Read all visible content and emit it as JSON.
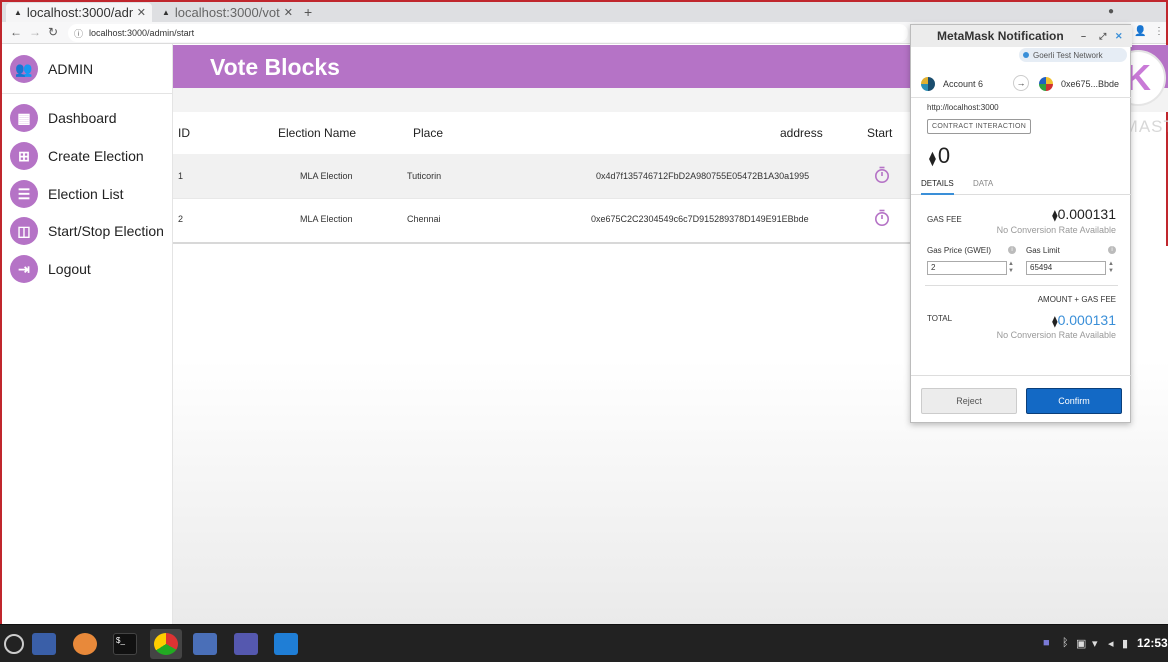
{
  "browser": {
    "tabs": [
      {
        "label": "localhost:3000/adm",
        "active": true
      },
      {
        "label": "localhost:3000/vot",
        "active": false
      }
    ],
    "url": "localhost:3000/admin/start"
  },
  "sidebar": {
    "title": "ADMIN",
    "items": [
      {
        "label": "Dashboard",
        "icon": "dashboard-icon"
      },
      {
        "label": "Create Election",
        "icon": "add-box-icon"
      },
      {
        "label": "Election List",
        "icon": "list-icon"
      },
      {
        "label": "Start/Stop Election",
        "icon": "start-stop-icon"
      },
      {
        "label": "Logout",
        "icon": "logout-icon"
      }
    ]
  },
  "header": {
    "title": "Vote Blocks"
  },
  "table": {
    "columns": [
      "ID",
      "Election Name",
      "Place",
      "address",
      "Start"
    ],
    "rows": [
      {
        "id": "1",
        "name": "MLA Election",
        "place": "Tuticorin",
        "address": "0x4d7f135746712FbD2A980755E05472B1A30a1995"
      },
      {
        "id": "2",
        "name": "MLA Election",
        "place": "Chennai",
        "address": "0xe675C2C2304549c6c7D915289378D149E91EBbde"
      }
    ]
  },
  "metamask": {
    "title": "MetaMask Notification",
    "network": "Goerli Test Network",
    "from_account": "Account 6",
    "to_account": "0xe675...Bbde",
    "origin": "http://localhost:3000",
    "interaction_label": "CONTRACT INTERACTION",
    "amount": "0",
    "tab_details": "DETAILS",
    "tab_data": "DATA",
    "gas_fee_label": "GAS FEE",
    "gas_fee_value": "0.000131",
    "no_conversion": "No Conversion Rate Available",
    "gas_price_label": "Gas Price (GWEI)",
    "gas_price_value": "2",
    "gas_limit_label": "Gas Limit",
    "gas_limit_value": "65494",
    "amount_gas_label": "AMOUNT + GAS FEE",
    "total_label": "TOTAL",
    "total_value": "0.000131",
    "reject_label": "Reject",
    "confirm_label": "Confirm"
  },
  "watermark": {
    "text": "KINEMAST",
    "logo_letter": "K"
  },
  "taskbar": {
    "clock": "12:53"
  },
  "colors": {
    "accent": "#b573c6",
    "confirm": "#1369c5",
    "link_blue": "#3a8fd8"
  }
}
